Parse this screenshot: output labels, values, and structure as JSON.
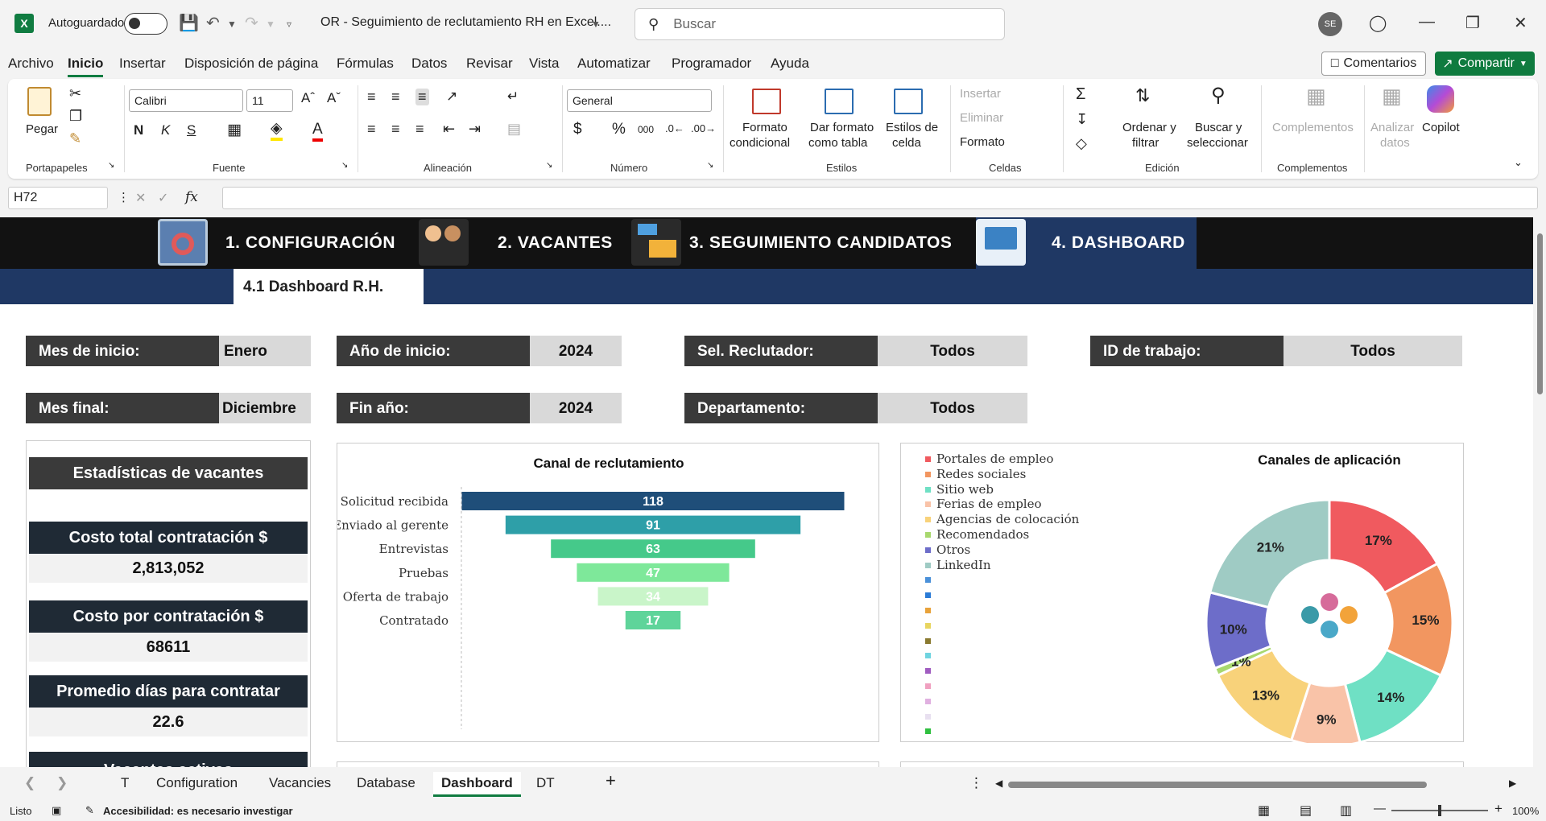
{
  "titlebar": {
    "autosave_label": "Autoguardado",
    "doc_title": "OR - Seguimiento de reclutamiento RH en Excel....",
    "search_placeholder": "Buscar",
    "avatar_initials": "SE"
  },
  "menu": [
    "Archivo",
    "Inicio",
    "Insertar",
    "Disposición de página",
    "Fórmulas",
    "Datos",
    "Revisar",
    "Vista",
    "Automatizar",
    "Programador",
    "Ayuda"
  ],
  "menu_active": "Inicio",
  "actions": {
    "comments": "Comentarios",
    "share": "Compartir"
  },
  "ribbon": {
    "groups": {
      "portapapeles": "Portapapeles",
      "fuente": "Fuente",
      "alineacion": "Alineación",
      "numero": "Número",
      "estilos": "Estilos",
      "celdas": "Celdas",
      "edicion": "Edición",
      "complementos": "Complementos"
    },
    "paste": "Pegar",
    "font_name": "Calibri",
    "font_size": "11",
    "number_format": "General",
    "bold": "N",
    "italic": "K",
    "underline": "S",
    "cond_format_1": "Formato",
    "cond_format_2": "condicional",
    "table_format_1": "Dar formato",
    "table_format_2": "como tabla",
    "cell_styles_1": "Estilos de",
    "cell_styles_2": "celda",
    "insert": "Insertar",
    "delete": "Eliminar",
    "format": "Formato",
    "sort_1": "Ordenar y",
    "sort_2": "filtrar",
    "find_1": "Buscar y",
    "find_2": "seleccionar",
    "addins": "Complementos",
    "analyze_1": "Analizar",
    "analyze_2": "datos",
    "copilot": "Copilot"
  },
  "formula_bar": {
    "cell_ref": "H72",
    "fx": "fx",
    "value": ""
  },
  "dashboard": {
    "nav": [
      "1. CONFIGURACIÓN",
      "2. VACANTES",
      "3. SEGUIMIENTO CANDIDATOS",
      "4. DASHBOARD"
    ],
    "subtab": "4.1 Dashboard R.H.",
    "filters": {
      "mes_inicio_label": "Mes de inicio:",
      "mes_inicio": "Enero",
      "mes_final_label": "Mes final:",
      "mes_final": "Diciembre",
      "anio_inicio_label": "Año de inicio:",
      "anio_inicio": "2024",
      "fin_anio_label": "Fin año:",
      "fin_anio": "2024",
      "reclutador_label": "Sel. Reclutador:",
      "reclutador": "Todos",
      "departamento_label": "Departamento:",
      "departamento": "Todos",
      "id_trabajo_label": "ID de trabajo:",
      "id_trabajo": "Todos"
    },
    "stats": {
      "title": "Estadísticas de vacantes",
      "costo_total_label": "Costo total contratación $",
      "costo_total": "2,813,052",
      "costo_por_label": "Costo por contratación $",
      "costo_por": "68611",
      "promedio_label": "Promedio días para contratar",
      "promedio": "22.6",
      "vacantes_label": "Vacantes activas"
    }
  },
  "chart_data": [
    {
      "type": "bar",
      "title": "Canal de reclutamiento",
      "orientation": "horizontal-funnel",
      "categories": [
        "Solicitud recibida",
        "Enviado al gerente",
        "Entrevistas",
        "Pruebas",
        "Oferta de trabajo",
        "Contratado"
      ],
      "values": [
        118,
        91,
        63,
        47,
        34,
        17
      ],
      "colors": [
        "#1f4e79",
        "#2e9fa8",
        "#45c98a",
        "#7ee89a",
        "#c9f5c9",
        "#5fd49a"
      ]
    },
    {
      "type": "pie",
      "style": "donut",
      "title": "Canales de aplicación",
      "legend_position": "left",
      "labels": [
        "Portales de empleo",
        "Redes sociales",
        "Sitio web",
        "Ferias de empleo",
        "Agencias de colocación",
        "Recomendados",
        "Otros",
        "LinkedIn"
      ],
      "values": [
        17,
        15,
        14,
        9,
        13,
        1,
        10,
        21
      ],
      "colors": [
        "#f05a5f",
        "#f29660",
        "#6fe0c4",
        "#f9c3a8",
        "#f8d27a",
        "#a8d86e",
        "#6d6dc9",
        "#9fcbc4"
      ],
      "extra_legend_colors": [
        "#4a90d9",
        "#2b7bd6",
        "#e8a23a",
        "#e8d560",
        "#8a7a30",
        "#6fd4e0",
        "#a05cc0",
        "#f0a0c0",
        "#e0b0e0",
        "#e8e0f0",
        "#30c040"
      ]
    }
  ],
  "sheet_tabs": [
    "T",
    "Configuration",
    "Vacancies",
    "Database",
    "Dashboard",
    "DT"
  ],
  "sheet_active": "Dashboard",
  "status": {
    "ready": "Listo",
    "accessibility": "Accesibilidad: es necesario investigar",
    "zoom": "100%"
  }
}
